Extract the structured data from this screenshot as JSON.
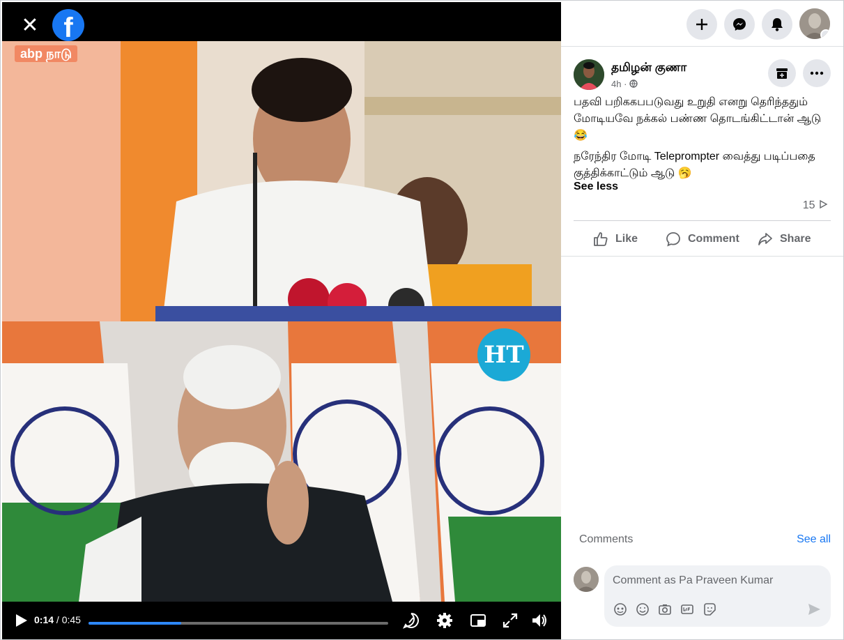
{
  "video": {
    "top_channel": "abp நாடு",
    "bottom_channel": "HT",
    "time_current": "0:14",
    "time_total": "/ 0:45",
    "progress_fraction": 0.31
  },
  "nav": {
    "create_icon": "plus-icon",
    "messenger_icon": "messenger-icon",
    "notifications_icon": "bell-icon"
  },
  "post": {
    "author": "தமிழன் குணா",
    "time": "4h ·",
    "paragraph1": "பதவி பறிககபபடுவது உறுதி எனறு தெரிந்ததும் மோடியவே நக்கல் பண்ண தொடங்கிட்டான் ஆடு 😂",
    "paragraph2": "நரேந்திர மோடி Teleprompter வைத்து படிப்பதை குத்திக்காட்டும் ஆடு 🥱",
    "see_less": "See less",
    "views": "15",
    "like": "Like",
    "comment": "Comment",
    "share": "Share"
  },
  "comments": {
    "label": "Comments",
    "see_all": "See all",
    "placeholder": "Comment as Pa Praveen Kumar"
  },
  "colors": {
    "brand": "#1877f2",
    "progress": "#2d88ff"
  }
}
